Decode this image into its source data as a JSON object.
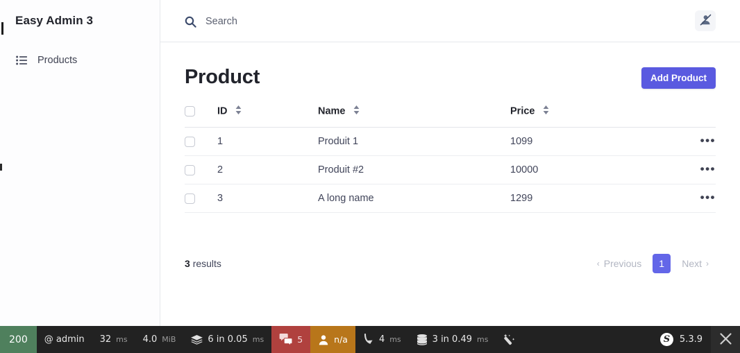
{
  "sidebar": {
    "brand": "Easy Admin 3",
    "items": [
      {
        "label": "Products",
        "icon": "list-ul-icon"
      }
    ]
  },
  "topbar": {
    "search_placeholder": "Search",
    "search_value": "",
    "search_icon": "search-icon",
    "user_menu_icon": "user-slash-icon"
  },
  "main": {
    "title": "Product",
    "add_button": "Add Product",
    "table": {
      "columns": [
        "ID",
        "Name",
        "Price"
      ],
      "rows": [
        {
          "id": "1",
          "name": "Produit 1",
          "price": "1099"
        },
        {
          "id": "2",
          "name": "Produit #2",
          "price": "10000"
        },
        {
          "id": "3",
          "name": "A long name",
          "price": "1299"
        }
      ],
      "actions_glyph": "•••"
    },
    "footer": {
      "results_count": "3",
      "results_label": "results",
      "previous": "Previous",
      "next": "Next",
      "current_page": "1"
    }
  },
  "debug_toolbar": {
    "status_code": "200",
    "user": "@ admin",
    "time_value": "32",
    "time_unit": "ms",
    "memory_value": "4.0",
    "memory_unit": "MiB",
    "cache_value": "6 in 0.05",
    "cache_unit": "ms",
    "translations_count": "5",
    "security_user": "n/a",
    "forward_value": "4",
    "forward_unit": "ms",
    "db_value": "3 in 0.49",
    "db_unit": "ms",
    "symfony_version": "5.3.9",
    "logo_letter": "S",
    "colors": {
      "status": "#4f805d",
      "translations": "#b0413e",
      "security": "#b8761a",
      "bar": "#222222"
    }
  },
  "theme": {
    "accent": "#5a5ae0",
    "page_bg": "#ffffff",
    "sidebar_bg": "#fdfdfe",
    "text": "#22242c"
  }
}
